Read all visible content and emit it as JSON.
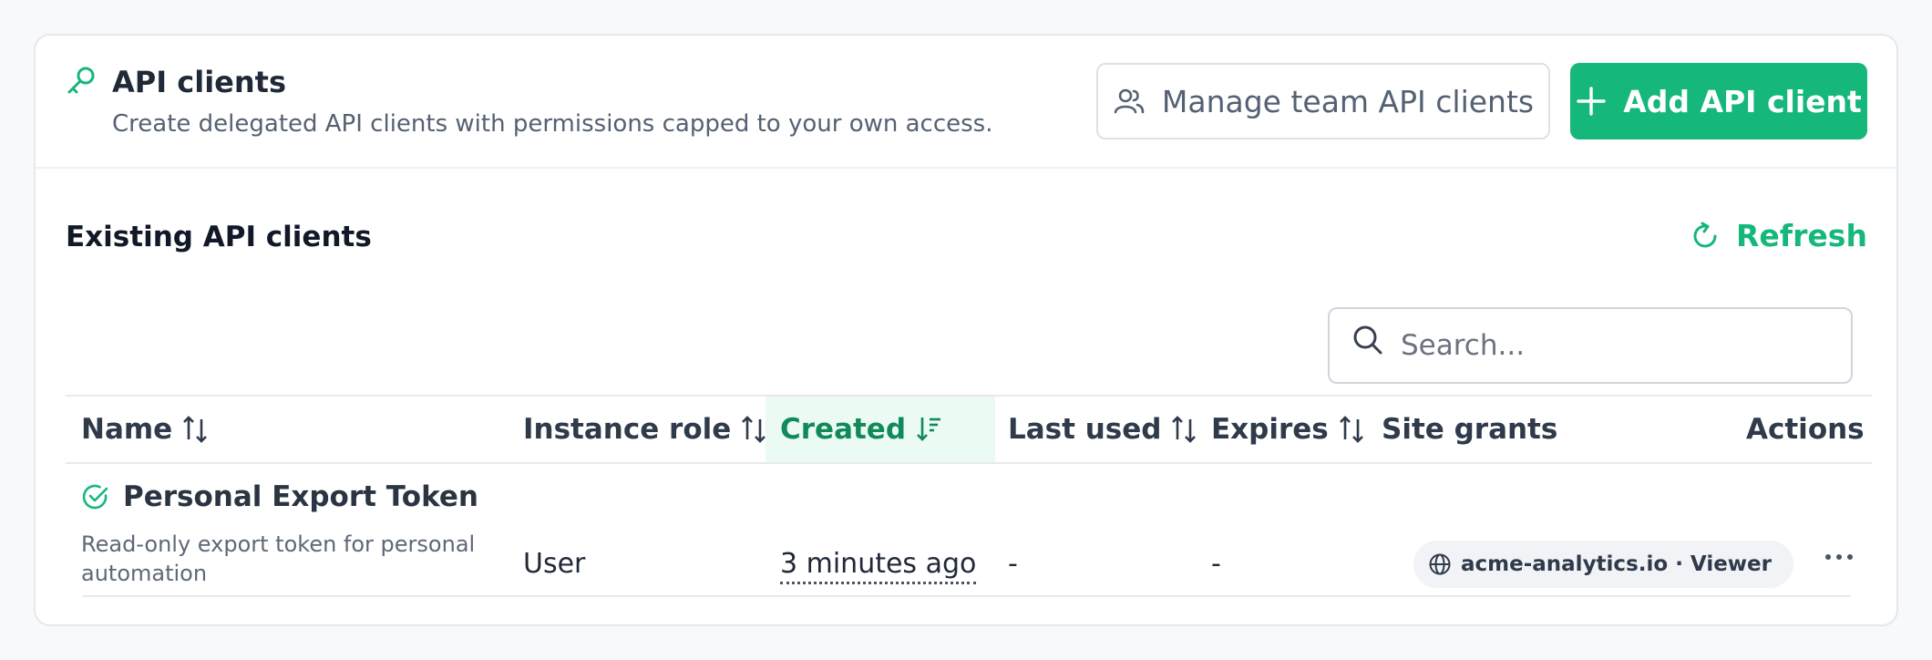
{
  "header": {
    "title": "API clients",
    "subtitle": "Create delegated API clients with permissions capped to your own access.",
    "manage_button": "Manage team API clients",
    "add_button": "Add API client"
  },
  "section": {
    "title": "Existing API clients",
    "refresh_label": "Refresh"
  },
  "search": {
    "placeholder": "Search..."
  },
  "table": {
    "columns": {
      "name": "Name",
      "instance_role": "Instance role",
      "created": "Created",
      "last_used": "Last used",
      "expires": "Expires",
      "site_grants": "Site grants",
      "actions": "Actions"
    },
    "sorted_column": "created",
    "rows": [
      {
        "name": "Personal Export Token",
        "description": "Read-only export token for personal automation",
        "instance_role": "User",
        "created": "3 minutes ago",
        "last_used": "-",
        "expires": "-",
        "site_grant": "acme-analytics.io · Viewer"
      }
    ]
  },
  "colors": {
    "accent": "#16b77a",
    "sorted_header_bg": "#ebfbf3",
    "sorted_header_text": "#118a5a",
    "badge_bg": "#f1f3f6"
  },
  "icons": {
    "header": "key-icon",
    "manage": "users-icon",
    "add": "plus-icon",
    "refresh": "refresh-icon",
    "search": "search-icon",
    "sort": "sort-arrows-icon",
    "sorted_desc": "sort-descending-icon",
    "status": "check-circle-icon",
    "grant": "globe-icon",
    "actions": "more-horizontal-icon"
  }
}
